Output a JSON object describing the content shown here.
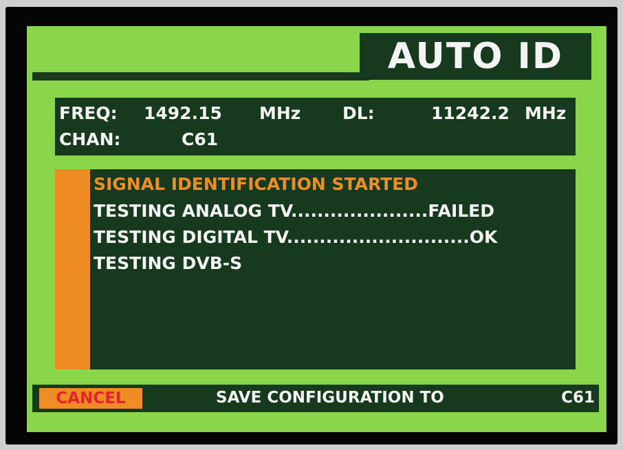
{
  "screen": {
    "title": "AUTO ID"
  },
  "tuning": {
    "freq_label": "FREQ:",
    "freq_value": "1492.15",
    "freq_unit": "MHz",
    "dl_label": "DL:",
    "dl_value": "11242.2",
    "dl_unit": "MHz",
    "chan_label": "CHAN:",
    "chan_value": "C61"
  },
  "log": {
    "header": "SIGNAL IDENTIFICATION STARTED",
    "lines": [
      "TESTING ANALOG TV.....................FAILED",
      "TESTING DIGITAL TV............................OK",
      "TESTING DVB-S"
    ]
  },
  "footer": {
    "cancel_label": "CANCEL",
    "save_label": "SAVE CONFIGURATION TO",
    "save_channel": "C61"
  },
  "colors": {
    "screen_green": "#8ad64a",
    "panel_dark": "#173a1e",
    "accent_orange": "#ef8c24",
    "cancel_red": "#e4232a",
    "text_white": "#f3f3f3"
  }
}
